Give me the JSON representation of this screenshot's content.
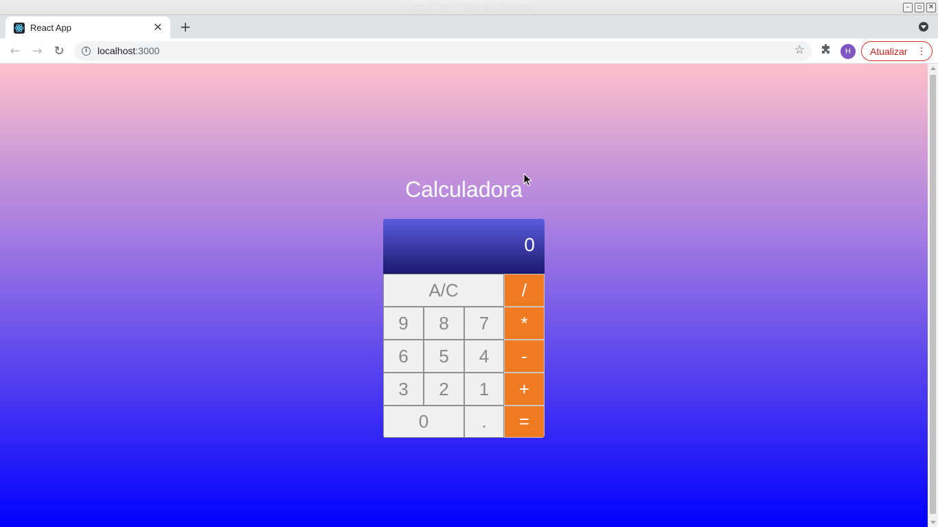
{
  "window": {
    "title": "React App - Google Chrome"
  },
  "tabs": [
    {
      "title": "React App",
      "close_glyph": "✕"
    }
  ],
  "new_tab_glyph": "+",
  "toolbar": {
    "back_glyph": "←",
    "forward_glyph": "→",
    "reload_glyph": "↻",
    "url_host": "localhost",
    "url_port": ":3000",
    "update_label": "Atualizar",
    "avatar_letter": "H",
    "info_glyph": "i"
  },
  "page": {
    "title": "Calculadora",
    "display_value": "0"
  },
  "keys": {
    "clear": "A/C",
    "divide": "/",
    "multiply": "*",
    "minus": "-",
    "plus": "+",
    "equals": "=",
    "n9": "9",
    "n8": "8",
    "n7": "7",
    "n6": "6",
    "n5": "5",
    "n4": "4",
    "n3": "3",
    "n2": "2",
    "n1": "1",
    "n0": "0",
    "dot": "."
  },
  "colors": {
    "operator": "#f07a22",
    "key_bg": "#f0f0f0",
    "gradient_top": "#ffc0cb",
    "gradient_bottom": "#0000ff"
  }
}
